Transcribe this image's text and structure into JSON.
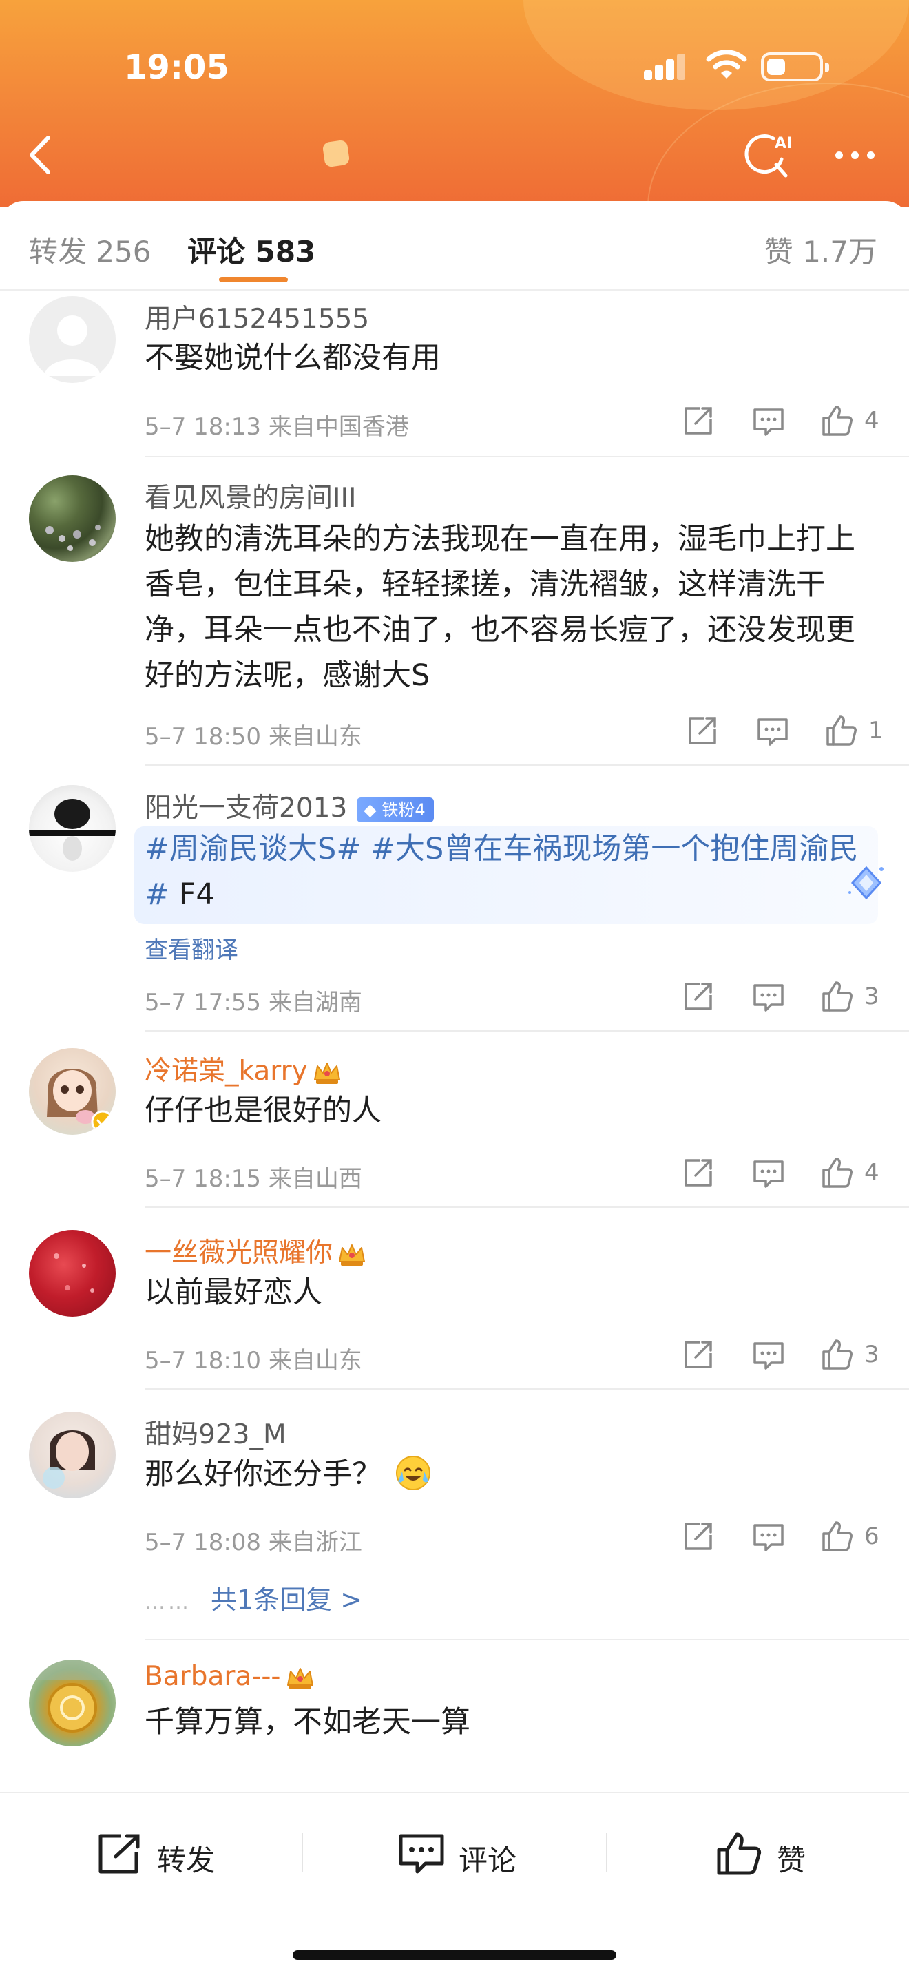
{
  "status_bar": {
    "time": "19:05"
  },
  "tabs": {
    "repost": "转发 256",
    "comment": "评论 583",
    "like": "赞 1.7万"
  },
  "comments": [
    {
      "username": "用户6152451555",
      "text": "不娶她说什么都没有用",
      "meta": "5–7 18:13  来自中国香港",
      "likes": "4"
    },
    {
      "username": "看见风景的房间III",
      "text": "她教的清洗耳朵的方法我现在一直在用，湿毛巾上打上香皂，包住耳朵，轻轻揉搓，清洗褶皱，这样清洗干净，耳朵一点也不油了，也不容易长痘了，还没发现更好的方法呢，感谢大S",
      "meta": "5–7 18:50  来自山东",
      "likes": "1"
    },
    {
      "username": "阳光一支荷2013",
      "badge": "铁粉4",
      "hashtag1": "#周渝民谈大S#",
      "hashtag2": "#大S曾在车祸现场第一个抱住周渝民#",
      "tail": " F4",
      "translate": "查看翻译",
      "meta": "5–7 17:55  来自湖南",
      "likes": "3"
    },
    {
      "username": "冷诺棠_karry",
      "text": "仔仔也是很好的人",
      "meta": "5–7 18:15  来自山西",
      "likes": "4"
    },
    {
      "username": "一丝薇光照耀你",
      "text": "以前最好恋人",
      "meta": "5–7 18:10  来自山东",
      "likes": "3"
    },
    {
      "username": "甜妈923_M",
      "text": "那么好你还分手？",
      "meta": "5–7 18:08  来自浙江",
      "likes": "6",
      "replies_dots": "……",
      "replies": "共1条回复 >"
    },
    {
      "username": "Barbara---",
      "text": "千算万算，不如老天一算"
    }
  ],
  "bottom_bar": {
    "repost": "转发",
    "comment": "评论",
    "like": "赞"
  },
  "colors": {
    "header_top": "#f7a23c",
    "header_bottom": "#ef6c35",
    "accent": "#f0862e",
    "vip_name": "#e8752c",
    "link": "#4f78b8"
  },
  "icons": [
    "back-icon",
    "ai-search-icon",
    "more-icon",
    "share-icon",
    "reply-icon",
    "like-icon",
    "crown-icon",
    "diamond-icon",
    "laugh-cry-emoji-icon"
  ]
}
